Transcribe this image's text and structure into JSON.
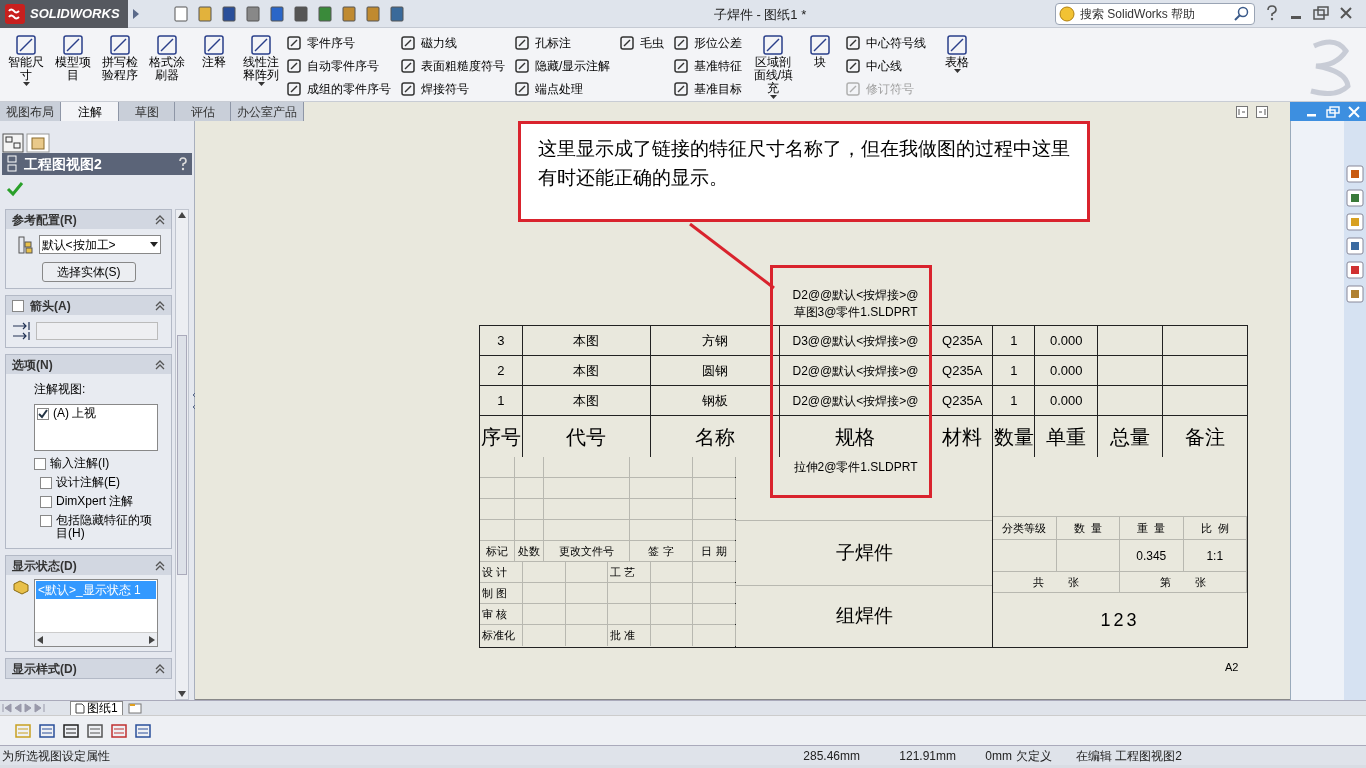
{
  "app": {
    "logo": "SOLIDWORKS",
    "title": "子焊件 - 图纸1 *",
    "search": {
      "placeholder": "搜索 SolidWorks 帮助"
    }
  },
  "ribbon": [
    {
      "kind": "large",
      "label": "智能尺寸",
      "dropdown": true
    },
    {
      "kind": "large",
      "label": "模型项目",
      "dropdown": false
    },
    {
      "kind": "large",
      "label": "拼写检验程序",
      "dropdown": false
    },
    {
      "kind": "large",
      "label": "格式涂刷器",
      "dropdown": false
    },
    {
      "kind": "large",
      "label": "注释",
      "dropdown": false
    },
    {
      "kind": "large",
      "label": "线性注释阵列",
      "dropdown": true
    },
    {
      "kind": "stack",
      "items": [
        {
          "label": "零件序号",
          "disabled": false
        },
        {
          "label": "自动零件序号",
          "disabled": false
        },
        {
          "label": "成组的零件序号",
          "disabled": false
        }
      ]
    },
    {
      "kind": "stack",
      "items": [
        {
          "label": "磁力线",
          "disabled": false
        },
        {
          "label": "表面粗糙度符号",
          "disabled": false
        },
        {
          "label": "焊接符号",
          "disabled": false
        }
      ]
    },
    {
      "kind": "stack",
      "items": [
        {
          "label": "孔标注",
          "disabled": false
        },
        {
          "label": "隐藏/显示注解",
          "disabled": false
        },
        {
          "label": "端点处理",
          "disabled": false
        }
      ]
    },
    {
      "kind": "stack",
      "items": [
        {
          "label": "毛虫",
          "disabled": false
        }
      ]
    },
    {
      "kind": "stack",
      "items": [
        {
          "label": "形位公差",
          "disabled": false
        },
        {
          "label": "基准特征",
          "disabled": false
        },
        {
          "label": "基准目标",
          "disabled": false
        }
      ]
    },
    {
      "kind": "large",
      "label": "区域剖面线/填充",
      "dropdown": true
    },
    {
      "kind": "large",
      "label": "块",
      "dropdown": false
    },
    {
      "kind": "stack",
      "items": [
        {
          "label": "中心符号线",
          "disabled": false
        },
        {
          "label": "中心线",
          "disabled": false
        },
        {
          "label": "修订符号",
          "disabled": true
        }
      ]
    },
    {
      "kind": "large",
      "label": "表格",
      "dropdown": true
    }
  ],
  "tabs": [
    {
      "label": "视图布局",
      "selected": false
    },
    {
      "label": "注解",
      "selected": true
    },
    {
      "label": "草图",
      "selected": false
    },
    {
      "label": "评估",
      "selected": false
    },
    {
      "label": "办公室产品",
      "selected": false
    }
  ],
  "property_manager": {
    "title": "工程图视图2",
    "sections": [
      {
        "kind": "config",
        "title": "参考配置(R)",
        "value": "默认<按加工>",
        "button": "选择实体(S)"
      },
      {
        "kind": "arrow",
        "title": "箭头(A)",
        "checked": false
      },
      {
        "kind": "options",
        "title": "选项(N)",
        "label": "注解视图:",
        "views": [
          {
            "label": "(A) 上视",
            "checked": true
          }
        ],
        "checks": [
          {
            "label": "输入注解(I)",
            "checked": false,
            "indent": false
          },
          {
            "label": "设计注解(E)",
            "checked": false,
            "indent": true
          },
          {
            "label": "DimXpert 注解",
            "checked": false,
            "indent": true
          },
          {
            "label": "包括隐藏特征的项目(H)",
            "checked": false,
            "indent": true
          }
        ]
      },
      {
        "kind": "states",
        "title": "显示状态(D)",
        "items": [
          {
            "label": "<默认>_显示状态 1",
            "selected": true
          }
        ]
      },
      {
        "kind": "header",
        "title": "显示样式(D)"
      }
    ]
  },
  "drawing": {
    "callout": "这里显示成了链接的特征尺寸名称了，但在我做图的过程中这里有时还能正确的显示。",
    "dimension_above": [
      "D2@@默认<按焊接>@",
      "草图3@零件1.SLDPRT"
    ],
    "dimension_below": "拉伸2@零件1.SLDPRT",
    "bom": {
      "columns": [
        "序号",
        "代号",
        "名称",
        "规格",
        "材料",
        "数量",
        "单重",
        "总量",
        "备注"
      ],
      "rows": [
        {
          "no": "3",
          "code": "本图",
          "name": "方钢",
          "spec": "D3@@默认<按焊接>@",
          "material": "Q235A",
          "qty": "1",
          "unit_weight": "0.000"
        },
        {
          "no": "2",
          "code": "本图",
          "name": "圆钢",
          "spec": "D2@@默认<按焊接>@",
          "material": "Q235A",
          "qty": "1",
          "unit_weight": "0.000"
        },
        {
          "no": "1",
          "code": "本图",
          "name": "钢板",
          "spec": "D2@@默认<按焊接>@",
          "material": "Q235A",
          "qty": "1",
          "unit_weight": "0.000"
        }
      ]
    },
    "title_block": {
      "revision_headers": [
        "标记",
        "处数",
        "更改文件号",
        "签 字",
        "日 期"
      ],
      "roles": [
        {
          "label": "设 计",
          "second": "工 艺"
        },
        {
          "label": "制 图"
        },
        {
          "label": "审 核"
        },
        {
          "label": "标准化",
          "second": "批 准"
        }
      ],
      "part_name": "子焊件",
      "assembly_name": "组焊件",
      "info_headers": [
        "分类等级",
        "数  量",
        "重  量",
        "比  例"
      ],
      "weight": "0.345",
      "scale": "1:1",
      "sheet_total": "共        张",
      "sheet_number": "第        张",
      "drawing_number": "123"
    },
    "sheet_size": "A2"
  },
  "sheet_tabs": [
    {
      "label": "图纸1",
      "selected": true
    }
  ],
  "status_bar": {
    "message": "为所选视图设定属性",
    "x": "285.46mm",
    "y": "121.91mm",
    "z": "0mm",
    "state": "欠定义",
    "mode": "在编辑 工程图视图2"
  }
}
